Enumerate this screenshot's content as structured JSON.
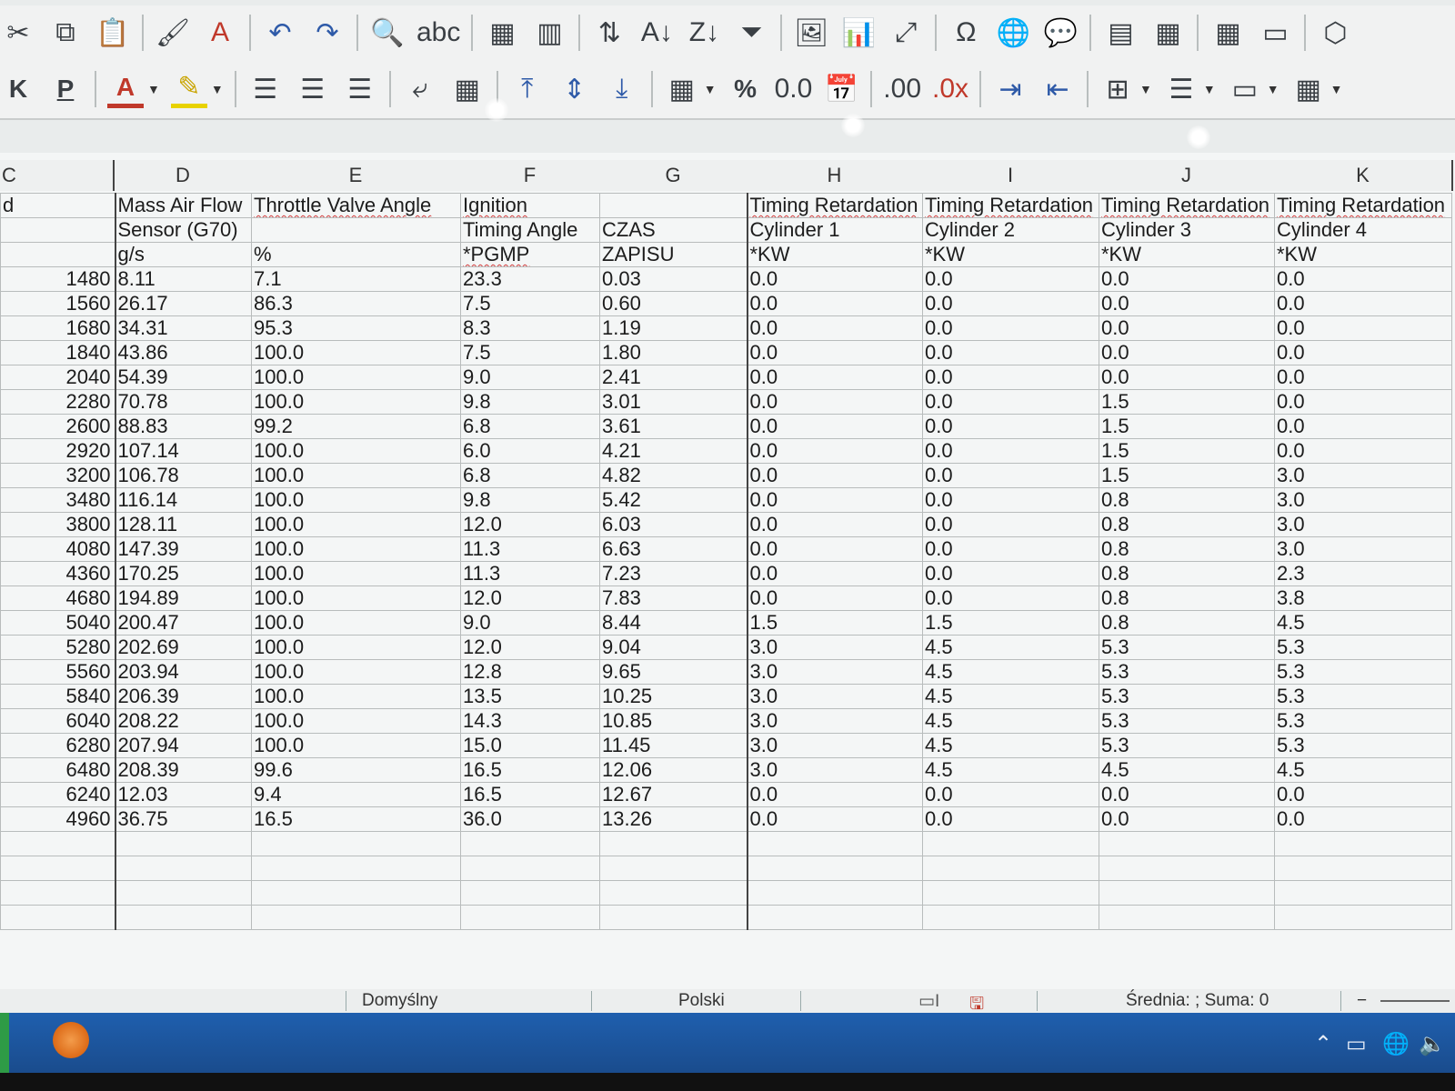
{
  "toolbar1": {
    "items": [
      {
        "name": "cut-icon",
        "glyph": "✂"
      },
      {
        "name": "copy-icon",
        "glyph": "⧉"
      },
      {
        "name": "paste-icon",
        "glyph": "📋"
      },
      {
        "name": "clone-formatting-icon",
        "glyph": "🖌"
      },
      {
        "name": "clear-formatting-icon",
        "glyph": "A"
      },
      {
        "name": "undo-icon",
        "glyph": "↶"
      },
      {
        "name": "redo-icon",
        "glyph": "↷"
      },
      {
        "name": "find-replace-icon",
        "glyph": "🔍"
      },
      {
        "name": "spelling-icon",
        "glyph": "abc"
      },
      {
        "name": "row-icon",
        "glyph": "▦"
      },
      {
        "name": "column-icon",
        "glyph": "▥"
      },
      {
        "name": "sort-icon",
        "glyph": "⇅"
      },
      {
        "name": "sort-ascending-icon",
        "glyph": "A↓"
      },
      {
        "name": "sort-descending-icon",
        "glyph": "Z↓"
      },
      {
        "name": "autofilter-icon",
        "glyph": "⏷"
      },
      {
        "name": "insert-image-icon",
        "glyph": "🖼"
      },
      {
        "name": "insert-chart-icon",
        "glyph": "📊"
      },
      {
        "name": "pivot-table-icon",
        "glyph": "⤢"
      },
      {
        "name": "special-character-icon",
        "glyph": "Ω"
      },
      {
        "name": "hyperlink-icon",
        "glyph": "🌐"
      },
      {
        "name": "comment-icon",
        "glyph": "💬"
      },
      {
        "name": "headers-footers-icon",
        "glyph": "▤"
      },
      {
        "name": "define-print-area-icon",
        "glyph": "▦"
      },
      {
        "name": "freeze-rows-columns-icon",
        "glyph": "▦"
      },
      {
        "name": "split-window-icon",
        "glyph": "▭"
      },
      {
        "name": "show-draw-functions-icon",
        "glyph": "⬡"
      }
    ]
  },
  "toolbar2": {
    "bold": "K",
    "underline": "P",
    "font_color_glyph": "A",
    "percent": "%",
    "number": "0.0",
    "add_decimal": ".00",
    "delete_decimal": ".0x"
  },
  "columns": {
    "row_header": "C",
    "letters": [
      "D",
      "E",
      "F",
      "G",
      "H",
      "I",
      "J",
      "K"
    ]
  },
  "header_rows": [
    [
      "d",
      "Mass Air Flow",
      "Throttle Valve Angle",
      "Ignition",
      "",
      "Timing Retardation",
      "Timing Retardation",
      "Timing Retardation",
      "Timing Retardation"
    ],
    [
      "",
      "Sensor (G70)",
      "",
      "Timing Angle",
      "CZAS",
      "Cylinder 1",
      "Cylinder 2",
      "Cylinder 3",
      "Cylinder 4"
    ],
    [
      "",
      "g/s",
      "%",
      "*PGMP",
      "ZAPISU",
      "*KW",
      "*KW",
      "*KW",
      "*KW"
    ]
  ],
  "data_rows": [
    [
      "1480",
      "8.11",
      "7.1",
      "23.3",
      "0.03",
      "0.0",
      "0.0",
      "0.0",
      "0.0"
    ],
    [
      "1560",
      "26.17",
      "86.3",
      "7.5",
      "0.60",
      "0.0",
      "0.0",
      "0.0",
      "0.0"
    ],
    [
      "1680",
      "34.31",
      "95.3",
      "8.3",
      "1.19",
      "0.0",
      "0.0",
      "0.0",
      "0.0"
    ],
    [
      "1840",
      "43.86",
      "100.0",
      "7.5",
      "1.80",
      "0.0",
      "0.0",
      "0.0",
      "0.0"
    ],
    [
      "2040",
      "54.39",
      "100.0",
      "9.0",
      "2.41",
      "0.0",
      "0.0",
      "0.0",
      "0.0"
    ],
    [
      "2280",
      "70.78",
      "100.0",
      "9.8",
      "3.01",
      "0.0",
      "0.0",
      "1.5",
      "0.0"
    ],
    [
      "2600",
      "88.83",
      "99.2",
      "6.8",
      "3.61",
      "0.0",
      "0.0",
      "1.5",
      "0.0"
    ],
    [
      "2920",
      "107.14",
      "100.0",
      "6.0",
      "4.21",
      "0.0",
      "0.0",
      "1.5",
      "0.0"
    ],
    [
      "3200",
      "106.78",
      "100.0",
      "6.8",
      "4.82",
      "0.0",
      "0.0",
      "1.5",
      "3.0"
    ],
    [
      "3480",
      "116.14",
      "100.0",
      "9.8",
      "5.42",
      "0.0",
      "0.0",
      "0.8",
      "3.0"
    ],
    [
      "3800",
      "128.11",
      "100.0",
      "12.0",
      "6.03",
      "0.0",
      "0.0",
      "0.8",
      "3.0"
    ],
    [
      "4080",
      "147.39",
      "100.0",
      "11.3",
      "6.63",
      "0.0",
      "0.0",
      "0.8",
      "3.0"
    ],
    [
      "4360",
      "170.25",
      "100.0",
      "11.3",
      "7.23",
      "0.0",
      "0.0",
      "0.8",
      "2.3"
    ],
    [
      "4680",
      "194.89",
      "100.0",
      "12.0",
      "7.83",
      "0.0",
      "0.0",
      "0.8",
      "3.8"
    ],
    [
      "5040",
      "200.47",
      "100.0",
      "9.0",
      "8.44",
      "1.5",
      "1.5",
      "0.8",
      "4.5"
    ],
    [
      "5280",
      "202.69",
      "100.0",
      "12.0",
      "9.04",
      "3.0",
      "4.5",
      "5.3",
      "5.3"
    ],
    [
      "5560",
      "203.94",
      "100.0",
      "12.8",
      "9.65",
      "3.0",
      "4.5",
      "5.3",
      "5.3"
    ],
    [
      "5840",
      "206.39",
      "100.0",
      "13.5",
      "10.25",
      "3.0",
      "4.5",
      "5.3",
      "5.3"
    ],
    [
      "6040",
      "208.22",
      "100.0",
      "14.3",
      "10.85",
      "3.0",
      "4.5",
      "5.3",
      "5.3"
    ],
    [
      "6280",
      "207.94",
      "100.0",
      "15.0",
      "11.45",
      "3.0",
      "4.5",
      "5.3",
      "5.3"
    ],
    [
      "6480",
      "208.39",
      "99.6",
      "16.5",
      "12.06",
      "3.0",
      "4.5",
      "4.5",
      "4.5"
    ],
    [
      "6240",
      "12.03",
      "9.4",
      "16.5",
      "12.67",
      "0.0",
      "0.0",
      "0.0",
      "0.0"
    ],
    [
      "4960",
      "36.75",
      "16.5",
      "36.0",
      "13.26",
      "0.0",
      "0.0",
      "0.0",
      "0.0"
    ]
  ],
  "status": {
    "page_style": "Domyślny",
    "language": "Polski",
    "summary": "Średnia: ; Suma: 0"
  }
}
